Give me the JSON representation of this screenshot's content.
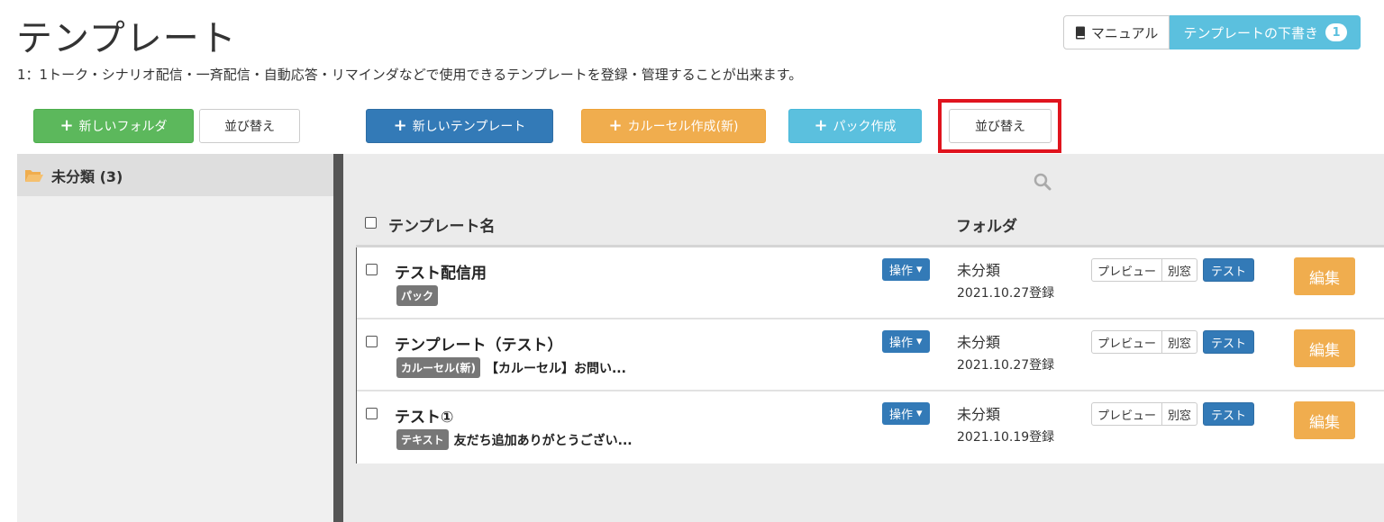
{
  "page": {
    "title": "テンプレート",
    "description": "1：1トーク・シナリオ配信・一斉配信・自動応答・リマインダなどで使用できるテンプレートを登録・管理することが出来ます。"
  },
  "top_right": {
    "manual_label": "マニュアル",
    "draft_label": "テンプレートの下書き",
    "draft_count": "1"
  },
  "toolbar": {
    "new_folder_label": "新しいフォルダ",
    "sort_folder_label": "並び替え",
    "new_template_label": "新しいテンプレート",
    "carousel_label": "カルーセル作成(新)",
    "pack_label": "パック作成",
    "sort_template_label": "並び替え"
  },
  "sidebar": {
    "folders": [
      {
        "label": "未分類 (3)"
      }
    ]
  },
  "table": {
    "header_name": "テンプレート名",
    "header_folder": "フォルダ",
    "rows": [
      {
        "title": "テスト配信用",
        "tag": "パック",
        "preview_text": "",
        "op_label": "操作",
        "folder": "未分類",
        "date": "2021.10.27登録",
        "preview_btn": "プレビュー",
        "window_btn": "別窓",
        "test_btn": "テスト",
        "edit_btn": "編集"
      },
      {
        "title": "テンプレート（テスト）",
        "tag": "カルーセル(新)",
        "preview_text": "【カルーセル】お問い...",
        "op_label": "操作",
        "folder": "未分類",
        "date": "2021.10.27登録",
        "preview_btn": "プレビュー",
        "window_btn": "別窓",
        "test_btn": "テスト",
        "edit_btn": "編集"
      },
      {
        "title": "テスト①",
        "tag": "テキスト",
        "preview_text": "友だち追加ありがとうござい...",
        "op_label": "操作",
        "folder": "未分類",
        "date": "2021.10.19登録",
        "preview_btn": "プレビュー",
        "window_btn": "別窓",
        "test_btn": "テスト",
        "edit_btn": "編集"
      }
    ]
  },
  "colors": {
    "green": "#5cb85c",
    "blue": "#337ab7",
    "orange": "#f0ad4e",
    "cyan": "#5bc0de",
    "highlight": "#e0141e"
  }
}
